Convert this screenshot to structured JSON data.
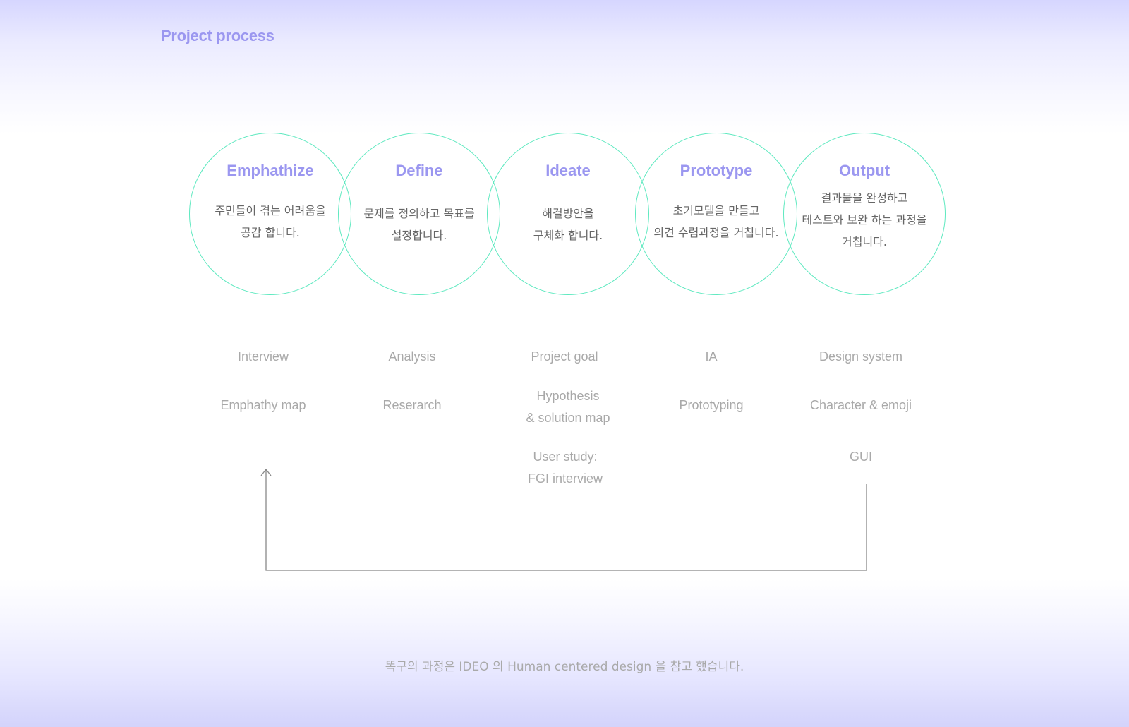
{
  "page": {
    "title": "Project process",
    "footnote": "똑구의 과정은 IDEO 의 Human centered design 을 참고 했습니다."
  },
  "colors": {
    "accent_purple": "#9b97f0",
    "circle_stroke": "#5fe9c0",
    "body_text": "#666666",
    "muted_text": "#a9a9a9",
    "arrow_line": "#888888"
  },
  "stages": [
    {
      "title": "Emphathize",
      "desc": [
        "주민들이 겪는 어려움을",
        "공감 합니다."
      ],
      "activities": [
        [
          "Interview"
        ],
        [
          "Emphathy map"
        ]
      ]
    },
    {
      "title": "Define",
      "desc": [
        "문제를 정의하고 목표를",
        "설정합니다."
      ],
      "activities": [
        [
          "Analysis"
        ],
        [
          "Reserarch"
        ]
      ]
    },
    {
      "title": "Ideate",
      "desc": [
        "해결방안을",
        "구체화 합니다."
      ],
      "activities": [
        [
          "Project goal"
        ],
        [
          "Hypothesis",
          "& solution map"
        ],
        [
          "User study:",
          "FGI interview"
        ]
      ]
    },
    {
      "title": "Prototype",
      "desc": [
        "초기모델을 만들고",
        "의견 수렴과정을 거칩니다."
      ],
      "activities": [
        [
          "IA"
        ],
        [
          "Prototyping"
        ]
      ]
    },
    {
      "title": "Output",
      "desc": [
        "결과물을 완성하고",
        "테스트와 보완 하는 과정을",
        "거칩니다."
      ],
      "activities": [
        [
          "Design system"
        ],
        [
          "Character & emoji"
        ],
        [
          "GUI"
        ]
      ]
    }
  ],
  "loop_arrow": {
    "from": "Output",
    "to": "Emphathize",
    "icon": "arrow-up-icon"
  }
}
